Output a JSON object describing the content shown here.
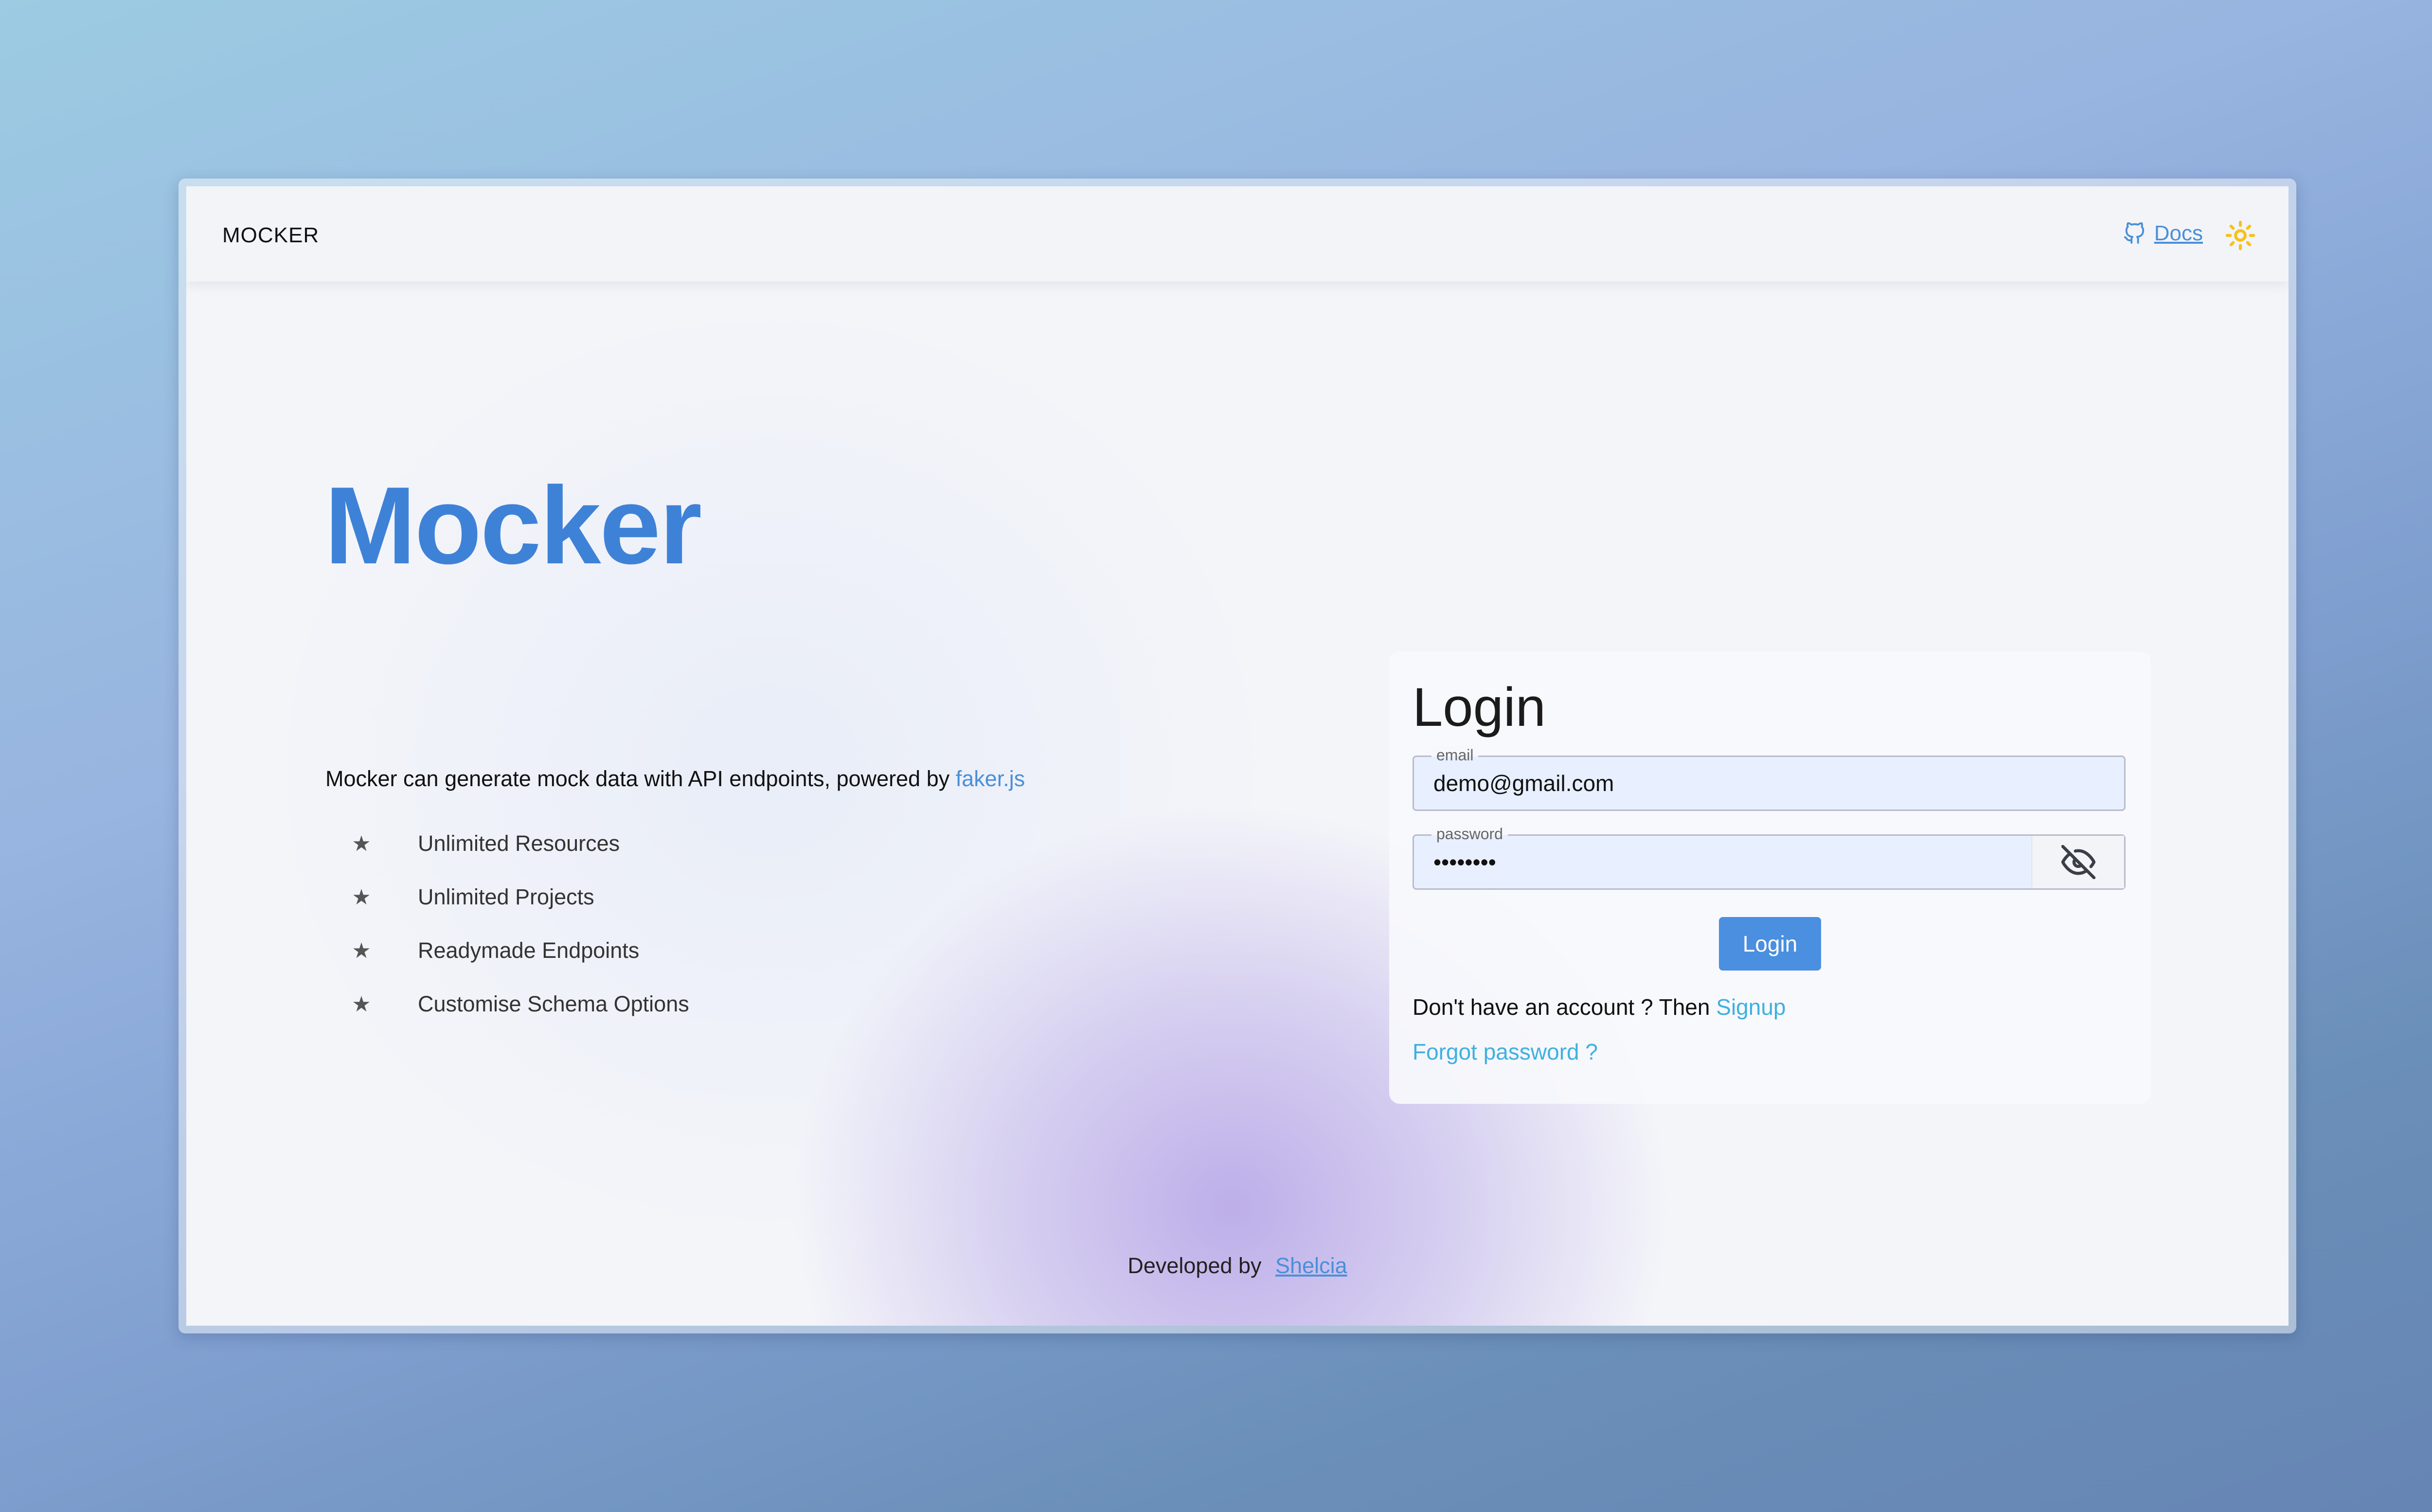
{
  "header": {
    "brand": "MOCKER",
    "docs_label": "Docs"
  },
  "hero": {
    "title": "Mocker",
    "description": "Mocker can generate mock data with API endpoints, powered by ",
    "description_link": "faker.js",
    "features": [
      "Unlimited Resources",
      "Unlimited Projects",
      "Readymade Endpoints",
      "Customise Schema Options"
    ]
  },
  "login": {
    "title": "Login",
    "email_label": "email",
    "email_value": "demo@gmail.com",
    "password_label": "password",
    "password_value": "demopass",
    "submit_label": "Login",
    "signup_prefix": "Don't have an account ? Then ",
    "signup_link": "Signup",
    "forgot_link": "Forgot password ?"
  },
  "footer": {
    "prefix": "Developed by",
    "author": "Shelcia"
  },
  "colors": {
    "accent": "#3e82d8",
    "button": "#4a8fe0",
    "link": "#3fb0e0",
    "sun": "#f5c21b"
  },
  "icons": [
    "github-icon",
    "sun-icon",
    "star-icon",
    "eye-off-icon"
  ]
}
